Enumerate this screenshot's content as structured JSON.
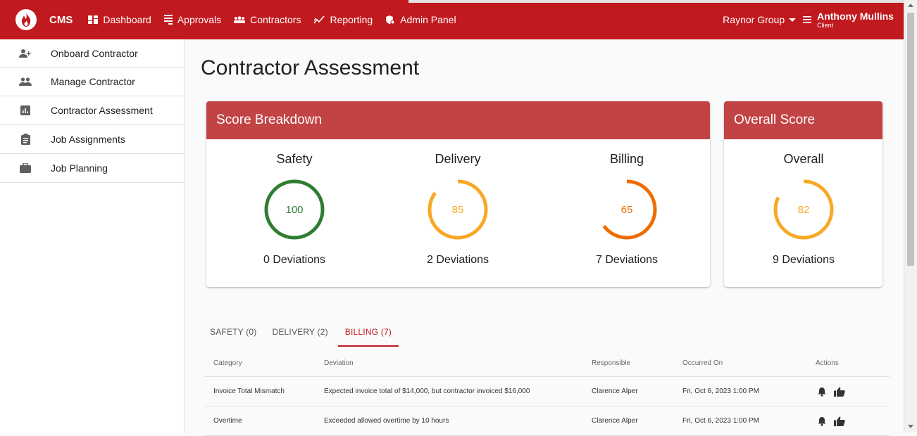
{
  "colors": {
    "brand": "#c0191e",
    "card_header": "#c24344",
    "safety": "#2e7d32",
    "delivery": "#f9a825",
    "billing": "#ef6c00",
    "overall": "#f9a825"
  },
  "app": {
    "name": "CMS",
    "logo_icon": "flame-icon"
  },
  "nav": [
    {
      "label": "Dashboard",
      "icon": "dashboard-icon"
    },
    {
      "label": "Approvals",
      "icon": "approvals-icon"
    },
    {
      "label": "Contractors",
      "icon": "contractors-icon"
    },
    {
      "label": "Reporting",
      "icon": "reporting-icon"
    },
    {
      "label": "Admin Panel",
      "icon": "admin-icon"
    }
  ],
  "org": {
    "name": "Raynor Group"
  },
  "user": {
    "name": "Anthony Mullins",
    "role": "Client"
  },
  "sidebar": {
    "items": [
      {
        "label": "Onboard Contractor",
        "icon": "person-add-icon"
      },
      {
        "label": "Manage Contractor",
        "icon": "people-icon"
      },
      {
        "label": "Contractor Assessment",
        "icon": "bar-chart-icon"
      },
      {
        "label": "Job Assignments",
        "icon": "clipboard-icon"
      },
      {
        "label": "Job Planning",
        "icon": "briefcase-icon"
      }
    ]
  },
  "page": {
    "title": "Contractor Assessment"
  },
  "score_breakdown": {
    "title": "Score Breakdown",
    "metrics": [
      {
        "name": "Safety",
        "score": "100",
        "fraction": 1.0,
        "deviations": "0 Deviations"
      },
      {
        "name": "Delivery",
        "score": "85",
        "fraction": 0.85,
        "deviations": "2 Deviations"
      },
      {
        "name": "Billing",
        "score": "65",
        "fraction": 0.65,
        "deviations": "7 Deviations"
      }
    ]
  },
  "overall": {
    "title": "Overall Score",
    "name": "Overall",
    "score": "82",
    "fraction": 0.82,
    "deviations": "9 Deviations"
  },
  "tabs": [
    {
      "label": "SAFETY (0)",
      "active": false
    },
    {
      "label": "DELIVERY (2)",
      "active": false
    },
    {
      "label": "BILLING (7)",
      "active": true
    }
  ],
  "table": {
    "headers": [
      "Category",
      "Deviation",
      "Responsible",
      "Occurred On",
      "Actions"
    ],
    "rows": [
      {
        "category": "Invoice Total Mismatch",
        "deviation": "Expected invoice total of $14,000, but contractor invoiced $16,000",
        "responsible": "Clarence Alper",
        "occurred": "Fri, Oct 6, 2023 1:00 PM"
      },
      {
        "category": "Overtime",
        "deviation": "Exceeded allowed overtime by 10 hours",
        "responsible": "Clarence Alper",
        "occurred": "Fri, Oct 6, 2023 1:00 PM"
      }
    ],
    "action_icons": [
      "bell-icon",
      "thumbs-up-icon"
    ]
  }
}
